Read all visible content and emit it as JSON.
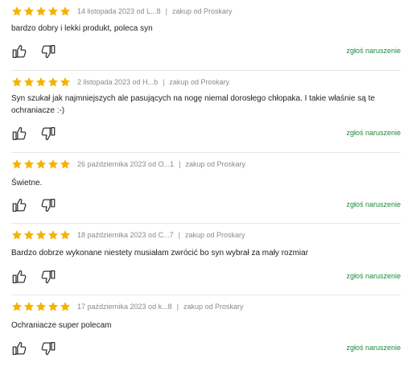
{
  "colors": {
    "star": "#f5b301",
    "report_link": "#1e8a3c",
    "meta": "#8a8a8a"
  },
  "reviews": [
    {
      "rating": 5,
      "date": "14 listopada 2023 od L...8",
      "purchase": "zakup od Proskary",
      "text": "bardzo dobry i lekki produkt, poleca syn",
      "report_label": "zgłoś naruszenie"
    },
    {
      "rating": 5,
      "date": "2 listopada 2023 od H...b",
      "purchase": "zakup od Proskary",
      "text": "Syn szukał jak najmniejszych ale pasujących na nogę niemal dorosłego chłopaka. I takie właśnie są te ochraniacze :-)",
      "report_label": "zgłoś naruszenie"
    },
    {
      "rating": 5,
      "date": "26 października 2023 od O...1",
      "purchase": "zakup od Proskary",
      "text": "Świetne.",
      "report_label": "zgłoś naruszenie"
    },
    {
      "rating": 5,
      "date": "18 października 2023 od C...7",
      "purchase": "zakup od Proskary",
      "text": "Bardzo dobrze wykonane niestety musiałam zwrócić bo syn wybrał za mały rozmiar",
      "report_label": "zgłoś naruszenie"
    },
    {
      "rating": 5,
      "date": "17 października 2023 od k...8",
      "purchase": "zakup od Proskary",
      "text": "Ochraniacze super polecam",
      "report_label": "zgłoś naruszenie"
    }
  ],
  "icons": {
    "star": "star-icon",
    "thumb_up": "thumbs-up-icon",
    "thumb_down": "thumbs-down-icon"
  }
}
